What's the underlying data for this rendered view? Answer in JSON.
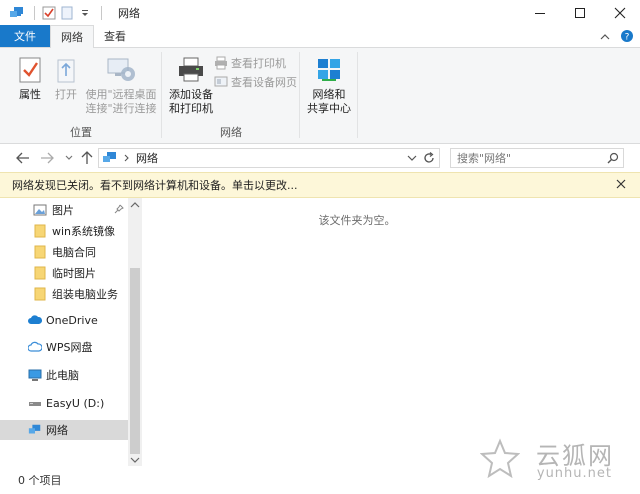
{
  "window": {
    "title": "网络",
    "minimize": "minimize",
    "maximize": "maximize",
    "close": "close"
  },
  "tabs": {
    "file": "文件",
    "network": "网络",
    "view": "查看"
  },
  "ribbon": {
    "location_group": {
      "label": "位置",
      "properties": "属性",
      "open": "打开",
      "remote_line1": "使用\"远程桌面",
      "remote_line2": "连接\"进行连接"
    },
    "network_group": {
      "label": "网络",
      "add_device_line1": "添加设备",
      "add_device_line2": "和打印机",
      "view_printers": "查看打印机",
      "view_device_page": "查看设备网页"
    },
    "sharing_group": {
      "label": "",
      "sharing_center_line1": "网络和",
      "sharing_center_line2": "共享中心"
    }
  },
  "address": {
    "crumb": "网络",
    "search_placeholder": "搜索\"网络\""
  },
  "infobar": {
    "text": "网络发现已关闭。看不到网络计算机和设备。单击以更改..."
  },
  "nav": {
    "items": [
      {
        "label": "图片"
      },
      {
        "label": "win系统镜像"
      },
      {
        "label": "电脑合同"
      },
      {
        "label": "临时图片"
      },
      {
        "label": "组装电脑业务"
      },
      {
        "label": "OneDrive"
      },
      {
        "label": "WPS网盘"
      },
      {
        "label": "此电脑"
      },
      {
        "label": "EasyU (D:)"
      },
      {
        "label": "网络"
      }
    ]
  },
  "content": {
    "empty_text": "该文件夹为空。"
  },
  "status": {
    "items_count": "0 个项目"
  },
  "watermark": {
    "cn": "云狐网",
    "url": "yunhu.net"
  },
  "colors": {
    "accent": "#1979ca",
    "infobar": "#fdf7d9",
    "ribbon": "#f5f6f7"
  }
}
